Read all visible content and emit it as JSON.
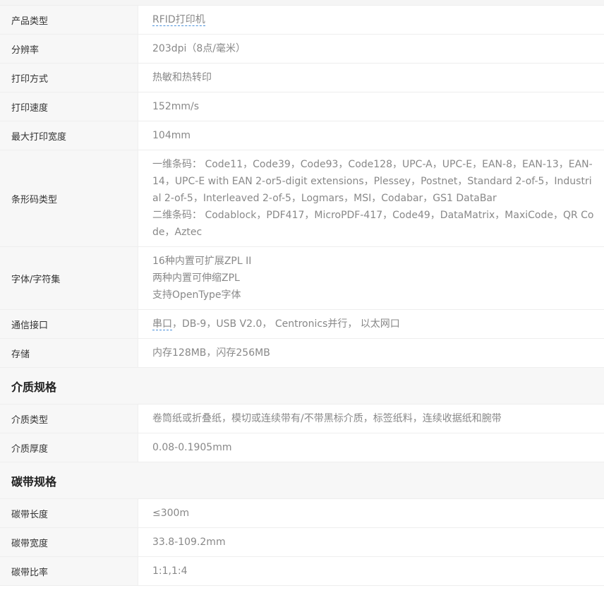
{
  "rows_general": [
    {
      "label": "产品类型",
      "link": "RFID打印机",
      "rest": ""
    },
    {
      "label": "分辨率",
      "value": "203dpi（8点/毫米）"
    },
    {
      "label": "打印方式",
      "value": "热敏和热转印"
    },
    {
      "label": "打印速度",
      "value": "152mm/s"
    },
    {
      "label": "最大打印宽度",
      "value": "104mm"
    }
  ],
  "barcode": {
    "label": "条形码类型",
    "line1": "一维条码： Code11，Code39，Code93，Code128，UPC-A，UPC-E，EAN-8，EAN-13，EAN-14，UPC-E with EAN 2-or5-digit extensions，Plessey，Postnet，Standard 2-of-5，Industrial 2-of-5，Interleaved 2-of-5，Logmars，MSI，Codabar，GS1 DataBar",
    "line2": "二维条码： Codablock，PDF417，MicroPDF-417，Code49，DataMatrix，MaxiCode，QR Code，Aztec"
  },
  "fonts": {
    "label": "字体/字符集",
    "lines": [
      "16种内置可扩展ZPL II",
      "两种内置可伸缩ZPL",
      "支持OpenType字体"
    ]
  },
  "interface": {
    "label": "通信接口",
    "link": "串口",
    "rest": "，DB-9，USB V2.0， Centronics并行， 以太网口"
  },
  "storage": {
    "label": "存储",
    "value": "内存128MB，闪存256MB"
  },
  "media_section": "介质规格",
  "media_rows": [
    {
      "label": "介质类型",
      "value": "卷筒纸或折叠纸，模切或连续带有/不带黑标介质，标签纸料，连续收据纸和腕带"
    },
    {
      "label": "介质厚度",
      "value": "0.08-0.1905mm"
    }
  ],
  "ribbon_section": "碳带规格",
  "ribbon_rows": [
    {
      "label": "碳带长度",
      "value": "≤300m"
    },
    {
      "label": "碳带宽度",
      "value": "33.8-109.2mm"
    },
    {
      "label": "碳带比率",
      "value": "1:1,1:4"
    }
  ]
}
